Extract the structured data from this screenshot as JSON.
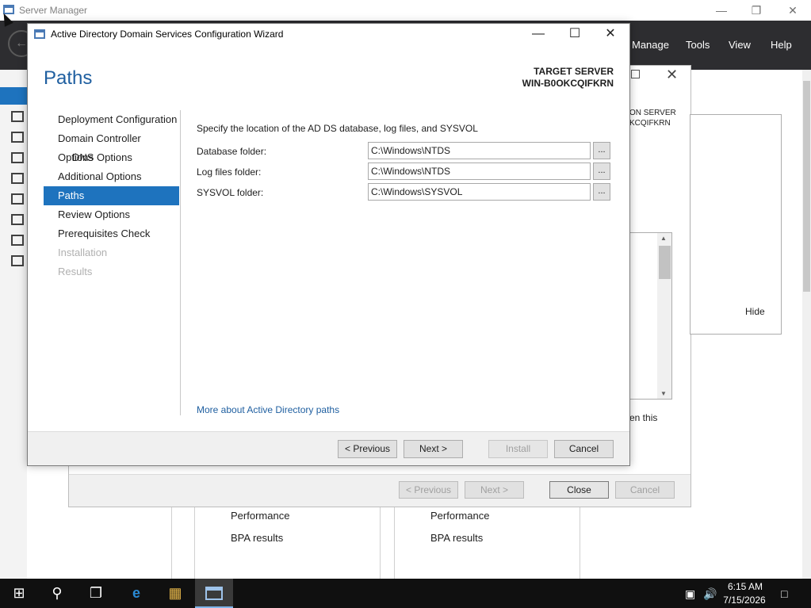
{
  "server_manager": {
    "title": "Server Manager",
    "menu": [
      "Manage",
      "Tools",
      "View",
      "Help"
    ]
  },
  "roles_wizard": {
    "target_server_partial": [
      "ON SERVER",
      "KCQIFKRN"
    ],
    "hide_label": "Hide",
    "when_text": "en this",
    "buttons": {
      "previous": "< Previous",
      "next": "Next >",
      "close": "Close",
      "cancel": "Cancel"
    }
  },
  "tiles": [
    {
      "items": [
        "Performance",
        "BPA results"
      ]
    },
    {
      "items": [
        "Performance",
        "BPA results"
      ]
    }
  ],
  "ad_wizard": {
    "title": "Active Directory Domain Services Configuration Wizard",
    "heading": "Paths",
    "target_server_label": "TARGET SERVER",
    "target_server_name": "WIN-B0OKCQIFKRN",
    "nav": [
      {
        "label": "Deployment Configuration",
        "state": "normal"
      },
      {
        "label": "Domain Controller Options",
        "state": "normal"
      },
      {
        "label": "DNS Options",
        "state": "sub"
      },
      {
        "label": "Additional Options",
        "state": "normal"
      },
      {
        "label": "Paths",
        "state": "active"
      },
      {
        "label": "Review Options",
        "state": "normal"
      },
      {
        "label": "Prerequisites Check",
        "state": "normal"
      },
      {
        "label": "Installation",
        "state": "disabled"
      },
      {
        "label": "Results",
        "state": "disabled"
      }
    ],
    "description": "Specify the location of the AD DS database, log files, and SYSVOL",
    "fields": [
      {
        "label": "Database folder:",
        "value": "C:\\Windows\\NTDS",
        "browse": "..."
      },
      {
        "label": "Log files folder:",
        "value": "C:\\Windows\\NTDS",
        "browse": "..."
      },
      {
        "label": "SYSVOL folder:",
        "value": "C:\\Windows\\SYSVOL",
        "browse": "..."
      }
    ],
    "more_link": "More about Active Directory paths",
    "buttons": {
      "previous": "< Previous",
      "next": "Next >",
      "install": "Install",
      "cancel": "Cancel"
    }
  },
  "taskbar": {
    "time": "6:15 AM",
    "date": "7/15/2026"
  }
}
